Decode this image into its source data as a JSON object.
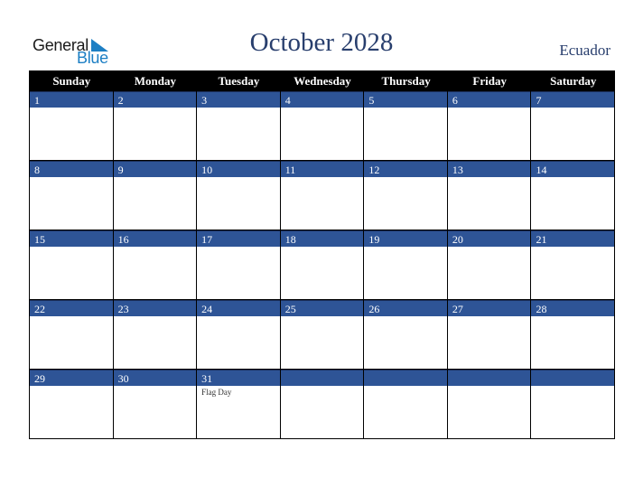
{
  "logo": {
    "word1": "General",
    "word2": "Blue"
  },
  "header": {
    "title": "October 2028",
    "country": "Ecuador"
  },
  "colors": {
    "accent": "#2e5496",
    "title": "#283e6d",
    "logo_blue": "#1d7fc4"
  },
  "weekdays": [
    "Sunday",
    "Monday",
    "Tuesday",
    "Wednesday",
    "Thursday",
    "Friday",
    "Saturday"
  ],
  "weeks": [
    [
      {
        "day": "1"
      },
      {
        "day": "2"
      },
      {
        "day": "3"
      },
      {
        "day": "4"
      },
      {
        "day": "5"
      },
      {
        "day": "6"
      },
      {
        "day": "7"
      }
    ],
    [
      {
        "day": "8"
      },
      {
        "day": "9"
      },
      {
        "day": "10"
      },
      {
        "day": "11"
      },
      {
        "day": "12"
      },
      {
        "day": "13"
      },
      {
        "day": "14"
      }
    ],
    [
      {
        "day": "15"
      },
      {
        "day": "16"
      },
      {
        "day": "17"
      },
      {
        "day": "18"
      },
      {
        "day": "19"
      },
      {
        "day": "20"
      },
      {
        "day": "21"
      }
    ],
    [
      {
        "day": "22"
      },
      {
        "day": "23"
      },
      {
        "day": "24"
      },
      {
        "day": "25"
      },
      {
        "day": "26"
      },
      {
        "day": "27"
      },
      {
        "day": "28"
      }
    ],
    [
      {
        "day": "29"
      },
      {
        "day": "30"
      },
      {
        "day": "31",
        "event": "Flag Day"
      },
      {
        "day": ""
      },
      {
        "day": ""
      },
      {
        "day": ""
      },
      {
        "day": ""
      }
    ]
  ]
}
